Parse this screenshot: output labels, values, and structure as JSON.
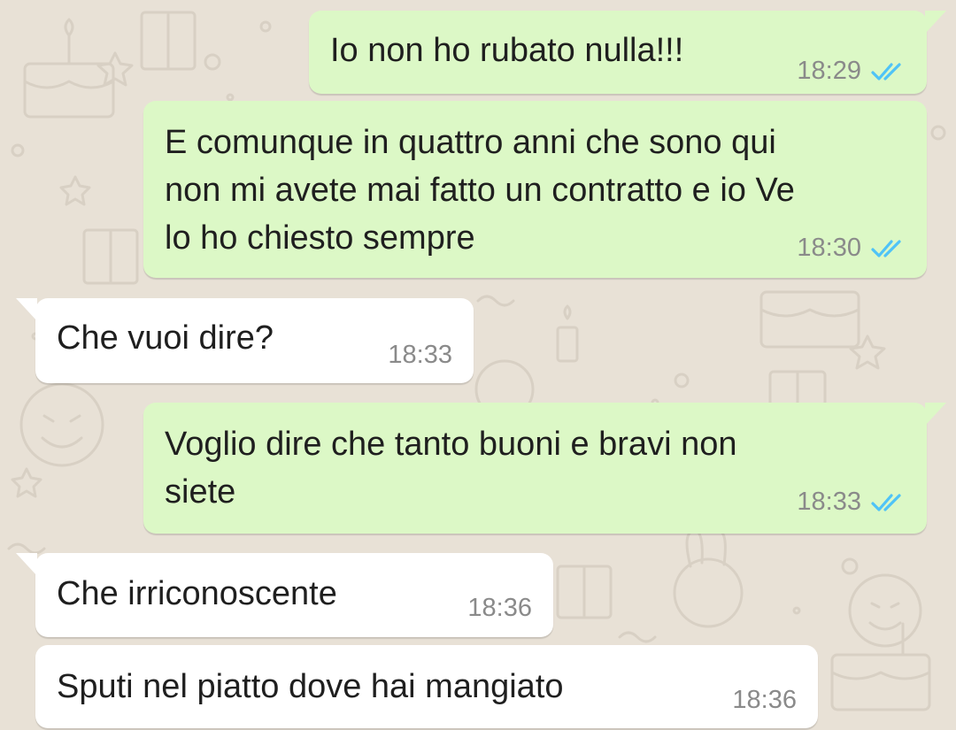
{
  "theme": {
    "outgoing_bubble": "#dcf8c6",
    "incoming_bubble": "#ffffff",
    "read_tick_color": "#4fc3f7",
    "chat_background": "#e8e1d6"
  },
  "messages": [
    {
      "direction": "outgoing",
      "text": "Io non ho rubato nulla!!!",
      "time": "18:29",
      "status": "read"
    },
    {
      "direction": "outgoing",
      "text": "E comunque in quattro anni che sono qui\nnon mi avete mai fatto un contratto e io Ve\nlo ho chiesto sempre",
      "time": "18:30",
      "status": "read"
    },
    {
      "direction": "incoming",
      "text": "Che vuoi dire?",
      "time": "18:33"
    },
    {
      "direction": "outgoing",
      "text": "Voglio dire che tanto buoni e bravi non\nsiete",
      "time": "18:33",
      "status": "read"
    },
    {
      "direction": "incoming",
      "text": "Che irriconoscente",
      "time": "18:36"
    },
    {
      "direction": "incoming",
      "text": "Sputi nel piatto dove hai mangiato",
      "time": "18:36"
    }
  ]
}
